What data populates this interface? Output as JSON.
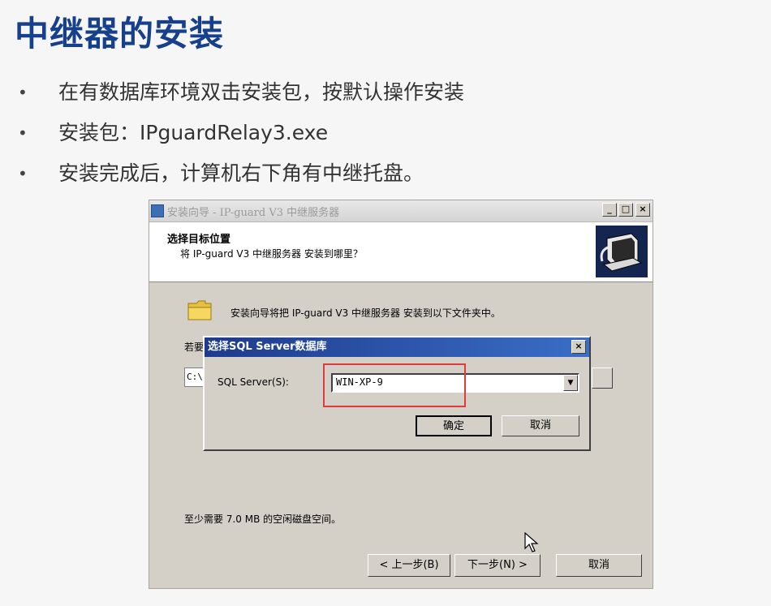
{
  "slide": {
    "title": "中继器的安装",
    "bullets": [
      "在有数据库环境双击安装包，按默认操作安装",
      "安装包：IPguardRelay3.exe",
      "安装完成后，计算机右下角有中继托盘。"
    ]
  },
  "installer": {
    "window_title": "安装向导 - IP-guard V3 中继服务器",
    "controls": {
      "minimize": "_",
      "maximize": "□",
      "close": "×"
    },
    "header_title": "选择目标位置",
    "header_subtitle": "将 IP-guard V3 中继服务器 安装到哪里？",
    "intro_text": "安装向导将把 IP-guard V3 中继服务器 安装到以下文件夹中。",
    "partial_label": "若要",
    "path_partial": "C:\\",
    "space_text": "至少需要 7.0 MB 的空闲磁盘空间。",
    "buttons": {
      "back": "< 上一步(B)",
      "next": "下一步(N) >",
      "cancel": "取消"
    }
  },
  "dialog": {
    "title": "选择SQL Server数据库",
    "close": "×",
    "label": "SQL Server(S):",
    "server_value": "WIN-XP-9",
    "ok": "确定",
    "cancel": "取消",
    "highlight_color": "#e0393e"
  },
  "colors": {
    "title_blue": "#17408c",
    "dialog_titlebar": "#1e3b8c"
  }
}
